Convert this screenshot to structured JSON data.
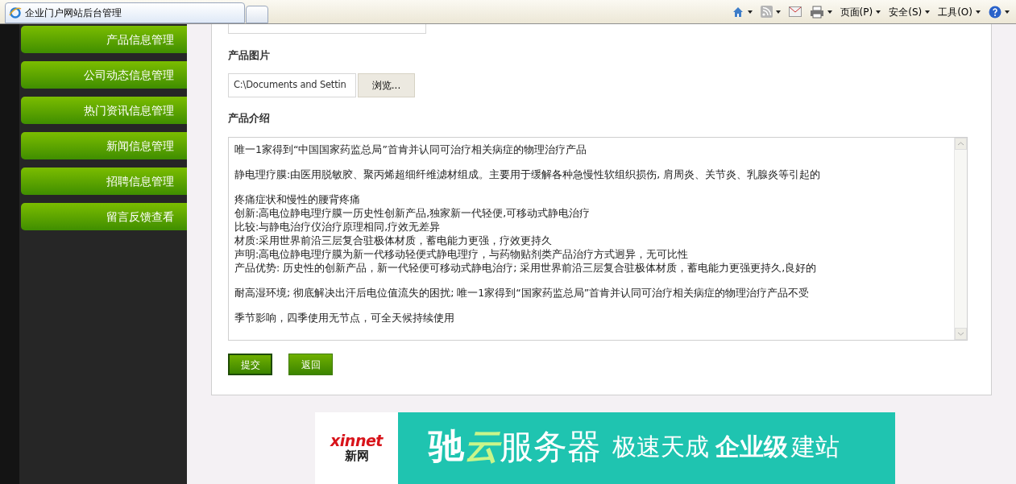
{
  "browser": {
    "tab_title": "企业门户网站后台管理",
    "menus": [
      "页面(P)",
      "安全(S)",
      "工具(O)"
    ]
  },
  "sidebar": {
    "items": [
      {
        "label": "产品信息管理"
      },
      {
        "label": "公司动态信息管理"
      },
      {
        "label": "热门资讯信息管理"
      },
      {
        "label": "新闻信息管理"
      },
      {
        "label": "招聘信息管理"
      },
      {
        "label": "留言反馈查看"
      }
    ]
  },
  "form": {
    "image_label": "产品图片",
    "file_value": "C:\\Documents and Settin",
    "browse_button": "浏览...",
    "intro_label": "产品介绍",
    "intro_blocks": [
      [
        "唯一1家得到“中国国家药监总局”首肯并认同可治疗相关病症的物理治疗产品"
      ],
      [
        "静电理疗膜:由医用脱敏胶、聚丙烯超细纤维滤材组成。主要用于缓解各种急慢性软组织损伤, 肩周炎、关节炎、乳腺炎等引起的"
      ],
      [
        "疼痛症状和慢性的腰背疼痛",
        "创新:高电位静电理疗膜一历史性创新产品,独家新一代轻便,可移动式静电治疗",
        "比较:与静电治疗仪治疗原理相同,疗效无差异",
        "材质:采用世界前沿三层复合驻极体材质，蓄电能力更强，疗效更持久",
        "声明:高电位静电理疗膜为新一代移动轻便式静电理疗，与药物贴剂类产品治疗方式迥异，无可比性",
        "产品优势: 历史性的创新产品，新一代轻便可移动式静电治疗; 采用世界前沿三层复合驻极体材质，蓄电能力更强更持久,良好的"
      ],
      [
        "耐高湿环境; 彻底解决出汗后电位值流失的困扰; 唯一1家得到“国家药监总局”首肯并认同可治疗相关病症的物理治疗产品不受"
      ],
      [
        "季节影响，四季使用无节点，可全天候持续使用"
      ]
    ],
    "buttons": [
      "提交",
      "返回"
    ]
  },
  "banner": {
    "logo": "xinnet",
    "logo_cn": "新网",
    "brand_1": "驰",
    "brand_2": "云",
    "brand_3": "服务器",
    "slogan_1": "极速天成",
    "slogan_2": "企业级",
    "slogan_3": "建站"
  }
}
